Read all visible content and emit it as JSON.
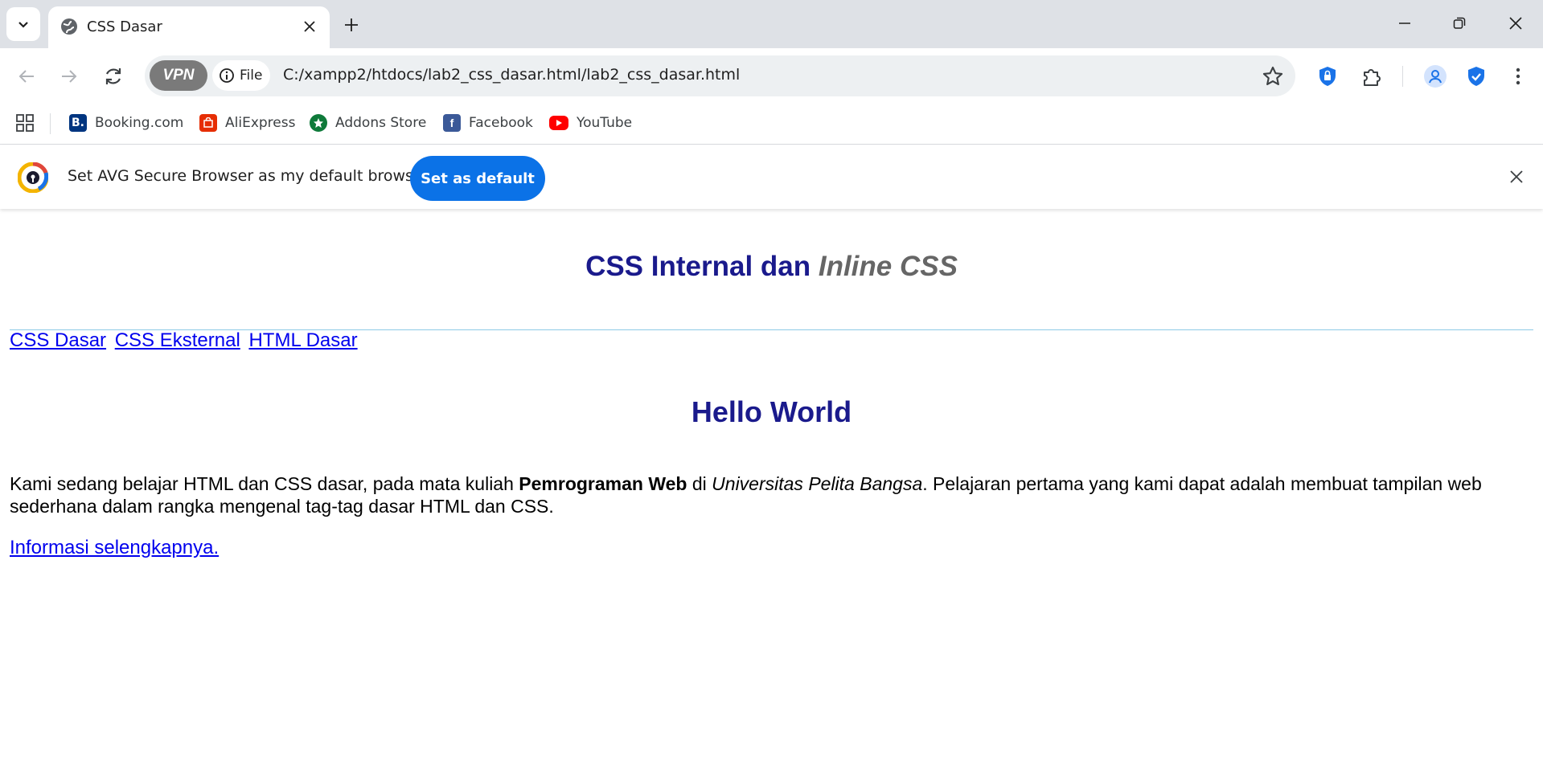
{
  "browser": {
    "tab_title": "CSS Dasar",
    "address": "C:/xampp2/htdocs/lab2_css_dasar.html/lab2_css_dasar.html",
    "vpn_label": "VPN",
    "file_chip": "File",
    "bookmarks": [
      {
        "label": "Booking.com",
        "icon": "booking-icon",
        "color": "#003580"
      },
      {
        "label": "AliExpress",
        "icon": "aliexpress-icon",
        "color": "#e62e04"
      },
      {
        "label": "Addons Store",
        "icon": "addons-store-icon",
        "color": "#0f7a3a"
      },
      {
        "label": "Facebook",
        "icon": "facebook-icon",
        "color": "#3b5998"
      },
      {
        "label": "YouTube",
        "icon": "youtube-icon",
        "color": "#ff0000"
      }
    ],
    "infobar": {
      "message": "Set AVG Secure Browser as my default browser",
      "button": "Set as default"
    }
  },
  "page": {
    "heading_a": "CSS Internal dan ",
    "heading_b": "Inline CSS",
    "nav": [
      "CSS Dasar",
      "CSS Eksternal",
      "HTML Dasar"
    ],
    "hello": "Hello World",
    "para_1": "Kami sedang belajar HTML dan CSS dasar, pada mata kuliah ",
    "para_bold": "Pemrograman Web",
    "para_2": " di ",
    "para_italic": "Universitas Pelita Bangsa",
    "para_3": ". Pelajaran pertama yang kami dapat adalah membuat tampilan web sederhana dalam rangka mengenal tag-tag dasar HTML dan CSS.",
    "more_link": "Informasi selengkapnya."
  },
  "colors": {
    "heading": "#1a1a8c",
    "inline_heading": "#666666",
    "link": "#0000ee",
    "accent_button": "#0b72e7"
  }
}
